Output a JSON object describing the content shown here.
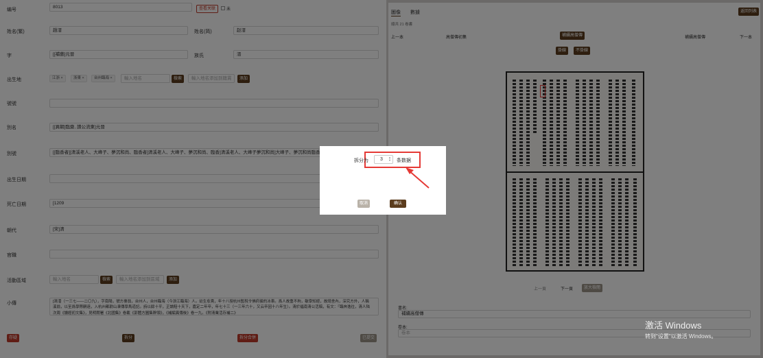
{
  "form": {
    "id_label": "编号",
    "id_value": "8013",
    "relation_btn": "查看关联",
    "checkbox_label": "未",
    "surname_label": "姓名(繁)",
    "surname_value": "趙溍",
    "surname_simple_label": "姓名(简)",
    "surname_simple_value": "赵溍",
    "zi_label": "字",
    "zi_value": "[[補藝]元晉",
    "clan_label": "族氏",
    "clan_value": "溍",
    "birthplace_label": "出生地",
    "birthplace_tags": [
      "江浙 ×",
      "浙東 ×",
      "台州臨海 ×"
    ],
    "birthplace_placeholder": "輸入地名",
    "search_btn": "檢索",
    "birthplace_add_placeholder": "輸入地名添加到籍貫",
    "add_btn": "添加",
    "hao_label": "號號",
    "hao_value": "",
    "alias_label": "別名",
    "alias_value": "[[異朝]臨齋, 讀公流東]元晉",
    "nick_label": "別號",
    "nick_value": "[[臨香者]]清溪老人、大峰子、夢沉和尚、臨香者]清溪老人、大峰子、夢沉和尚、臨香]清溪老人、大峰子夢沉和尚]大峰子、夢沉和尚臨香者、清",
    "birth_label": "出生日期",
    "birth_value": "",
    "death_label": "死亡日期",
    "death_value": "[1209",
    "dynasty_label": "朝代",
    "dynasty_value": "[宋]清",
    "office_label": "官職",
    "office_value": "",
    "region_label": "活動區域",
    "region_placeholder": "輸入地名",
    "region_add_placeholder": "輸入地名添加到區域",
    "bio_label": "小傳",
    "bio_value": "[清溍（一三七——二〇九），字南陽，號方臺翁，台州人，台州臨海（今浙江臨海）人。幼生愈貴，年十八授杭州監稅令佛府據的冰車。爲人故重不拘，敏學知經，故請舍內，深究方外，人稱溪翁，以至爲學際嗣遠，入杭州都尉山凍傳學馬道記。詩以餘十平，正論賠十天下，嘉定二年卒，年七十三（一三年六十，又云卒因十八年生）。清於福南清公活稿，有文：『臨奔逸往，清人陆次周《讀經初文集》，見明朗署《北國集》卷載《郭體方圓集幹頭》，《補編異傳後》卷一九。《附清業活存補二》",
    "save_btn": "存疑",
    "split_btn": "拆分",
    "split_merge_btn": "拆分合併",
    "submit_btn": "已提交"
  },
  "right": {
    "tab_image": "圖像",
    "tab_data": "數據",
    "back_btn": "返回列表",
    "total_text": "總共 21 卷書",
    "prev_label": "上一本",
    "book_left": "高僧傳初集",
    "book_center": "補續高僧傳",
    "book_right": "補續高僧傳",
    "next_label": "下一本",
    "mount_btn": "掛線",
    "unmount_btn": "不掛線",
    "prev_page": "上一頁",
    "next_page": "下一頁",
    "zoom_btn": "放大檢閱",
    "book_name_label": "書名:",
    "book_name_value": "補續高僧傳",
    "volume_label": "卷本:",
    "volume_placeholder": "卷本"
  },
  "modal": {
    "prefix": "拆分为",
    "count": "3",
    "suffix": "条数据",
    "cancel": "取消",
    "confirm": "确认"
  },
  "watermark": {
    "title": "激活 Windows",
    "subtitle": "转到\"设置\"以激活 Windows。"
  },
  "colors": {
    "brand_brown": "#5c3d1e",
    "accent_red": "#c13a2a",
    "annotation_red": "#e53935"
  }
}
